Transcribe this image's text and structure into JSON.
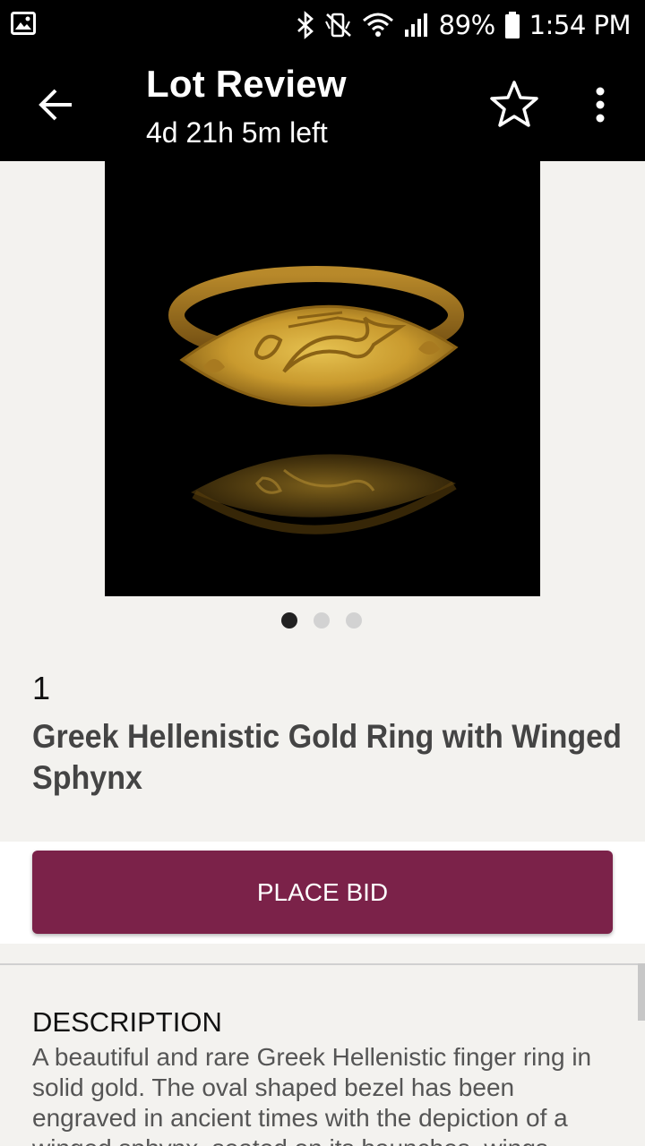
{
  "status_bar": {
    "battery": "89%",
    "time": "1:54 PM",
    "icons": [
      "gallery-icon",
      "bluetooth-icon",
      "mute-icon",
      "wifi-icon",
      "signal-icon",
      "battery-icon"
    ]
  },
  "app_bar": {
    "title": "Lot Review",
    "subtitle": "4d 21h 5m left",
    "icons": [
      "back-arrow-icon",
      "star-outline-icon",
      "more-vertical-icon"
    ]
  },
  "gallery": {
    "image_count": 3,
    "active_index": 0
  },
  "lot": {
    "number": "1",
    "title": "Greek Hellenistic Gold Ring with Winged Sphynx"
  },
  "actions": {
    "place_bid_label": "PLACE BID"
  },
  "description": {
    "heading": "DESCRIPTION",
    "body": "A beautiful and rare Greek Hellenistic finger ring in solid gold. The oval shaped bezel has been engraved in ancient times with the depiction of a winged sphynx, seated on its haunches, wings"
  },
  "colors": {
    "app_bar_bg": "#000000",
    "page_bg": "#f3f2ef",
    "bid_button": "#7b2249"
  }
}
